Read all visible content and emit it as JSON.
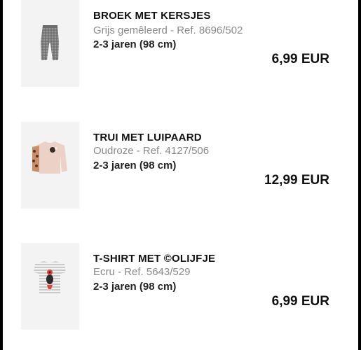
{
  "cart": {
    "items": [
      {
        "name": "BROEK MET KERSJES",
        "color_ref": "Grijs gemêleerd - Ref. 8696/502",
        "size": "2-3 jaren (98 cm)",
        "price": "6,99 EUR"
      },
      {
        "name": "TRUI MET LUIPAARD",
        "color_ref": "Oudroze - Ref. 4127/506",
        "size": "2-3 jaren (98 cm)",
        "price": "12,99 EUR"
      },
      {
        "name": "T-SHIRT MET ©OLIJFJE",
        "color_ref": "Ecru - Ref. 5643/529",
        "size": "2-3 jaren (98 cm)",
        "price": "6,99 EUR"
      }
    ]
  }
}
